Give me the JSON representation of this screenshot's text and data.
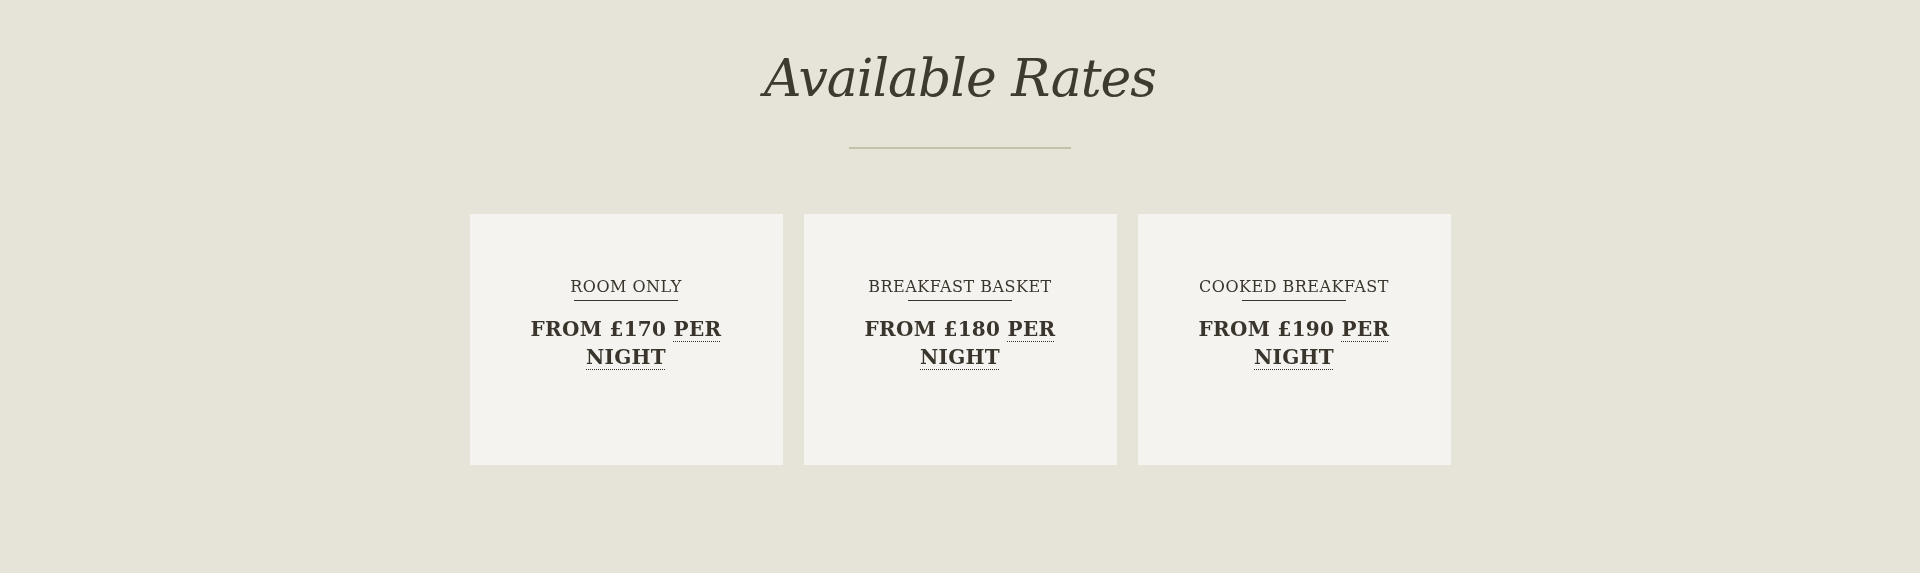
{
  "title": "Available Rates",
  "rates": [
    {
      "name": "ROOM ONLY",
      "price": "FROM £170",
      "unit": "PER NIGHT"
    },
    {
      "name": "BREAKFAST BASKET",
      "price": "FROM £180",
      "unit": "PER NIGHT"
    },
    {
      "name": "COOKED BREAKFAST",
      "price": "FROM £190",
      "unit": "PER NIGHT"
    }
  ]
}
